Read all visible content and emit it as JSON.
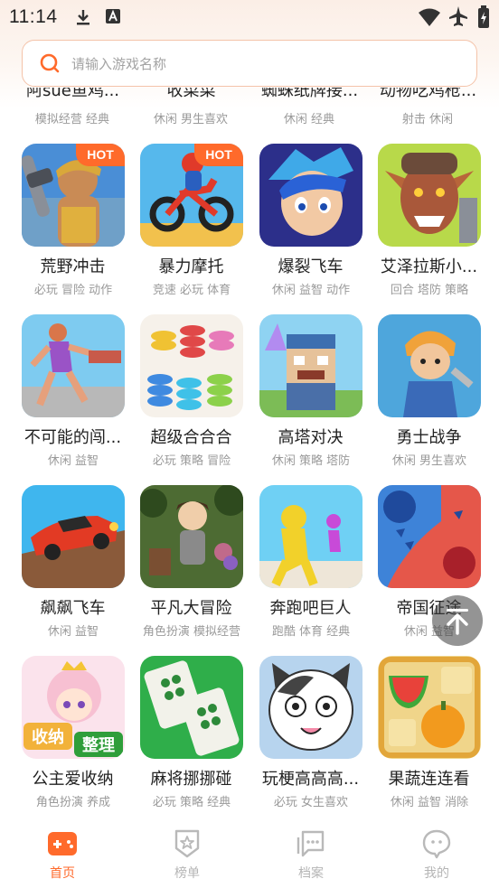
{
  "status_bar": {
    "time": "11:14"
  },
  "search": {
    "placeholder": "请输入游戏名称"
  },
  "partial_row": [
    {
      "title": "阿sue鱼鸡...",
      "tags": "模拟经营 经典"
    },
    {
      "title": "收菜菜",
      "tags": "休闲 男生喜欢"
    },
    {
      "title": "蜘蛛纸牌接...",
      "tags": "休闲 经典"
    },
    {
      "title": "动物吃鸡枪...",
      "tags": "射击 休闲"
    }
  ],
  "games": [
    {
      "title": "荒野冲击",
      "tags": "必玩 冒险 动作",
      "hot": "HOT"
    },
    {
      "title": "暴力摩托",
      "tags": "竞速 必玩 体育",
      "hot": "HOT"
    },
    {
      "title": "爆裂飞车",
      "tags": "休闲 益智 动作"
    },
    {
      "title": "艾泽拉斯小...",
      "tags": "回合 塔防 策略"
    },
    {
      "title": "不可能的闯...",
      "tags": "休闲 益智"
    },
    {
      "title": "超级合合合",
      "tags": "必玩 策略 冒险"
    },
    {
      "title": "高塔对决",
      "tags": "休闲 策略 塔防"
    },
    {
      "title": "勇士战争",
      "tags": "休闲 男生喜欢"
    },
    {
      "title": "飙飙飞车",
      "tags": "休闲 益智"
    },
    {
      "title": "平凡大冒险",
      "tags": "角色扮演 模拟经营"
    },
    {
      "title": "奔跑吧巨人",
      "tags": "跑酷 体育 经典"
    },
    {
      "title": "帝国征途",
      "tags": "休闲 益智"
    },
    {
      "title": "公主爱收纳",
      "tags": "角色扮演 养成"
    },
    {
      "title": "麻将挪挪碰",
      "tags": "必玩 策略 经典"
    },
    {
      "title": "玩梗高高高...",
      "tags": "必玩 女生喜欢"
    },
    {
      "title": "果蔬连连看",
      "tags": "休闲 益智 消除"
    }
  ],
  "tile_texts": {
    "princess_1": "收纳",
    "princess_2": "整理"
  },
  "nav": [
    {
      "label": "首页",
      "icon": "gamepad-icon",
      "active": true
    },
    {
      "label": "榜单",
      "icon": "trophy-star-icon"
    },
    {
      "label": "档案",
      "icon": "chat-archive-icon"
    },
    {
      "label": "我的",
      "icon": "chat-profile-icon"
    }
  ],
  "colors": {
    "accent": "#ff6a2b",
    "hot_badge": "#ff6a2b",
    "search_border": "#f4c3a9"
  }
}
